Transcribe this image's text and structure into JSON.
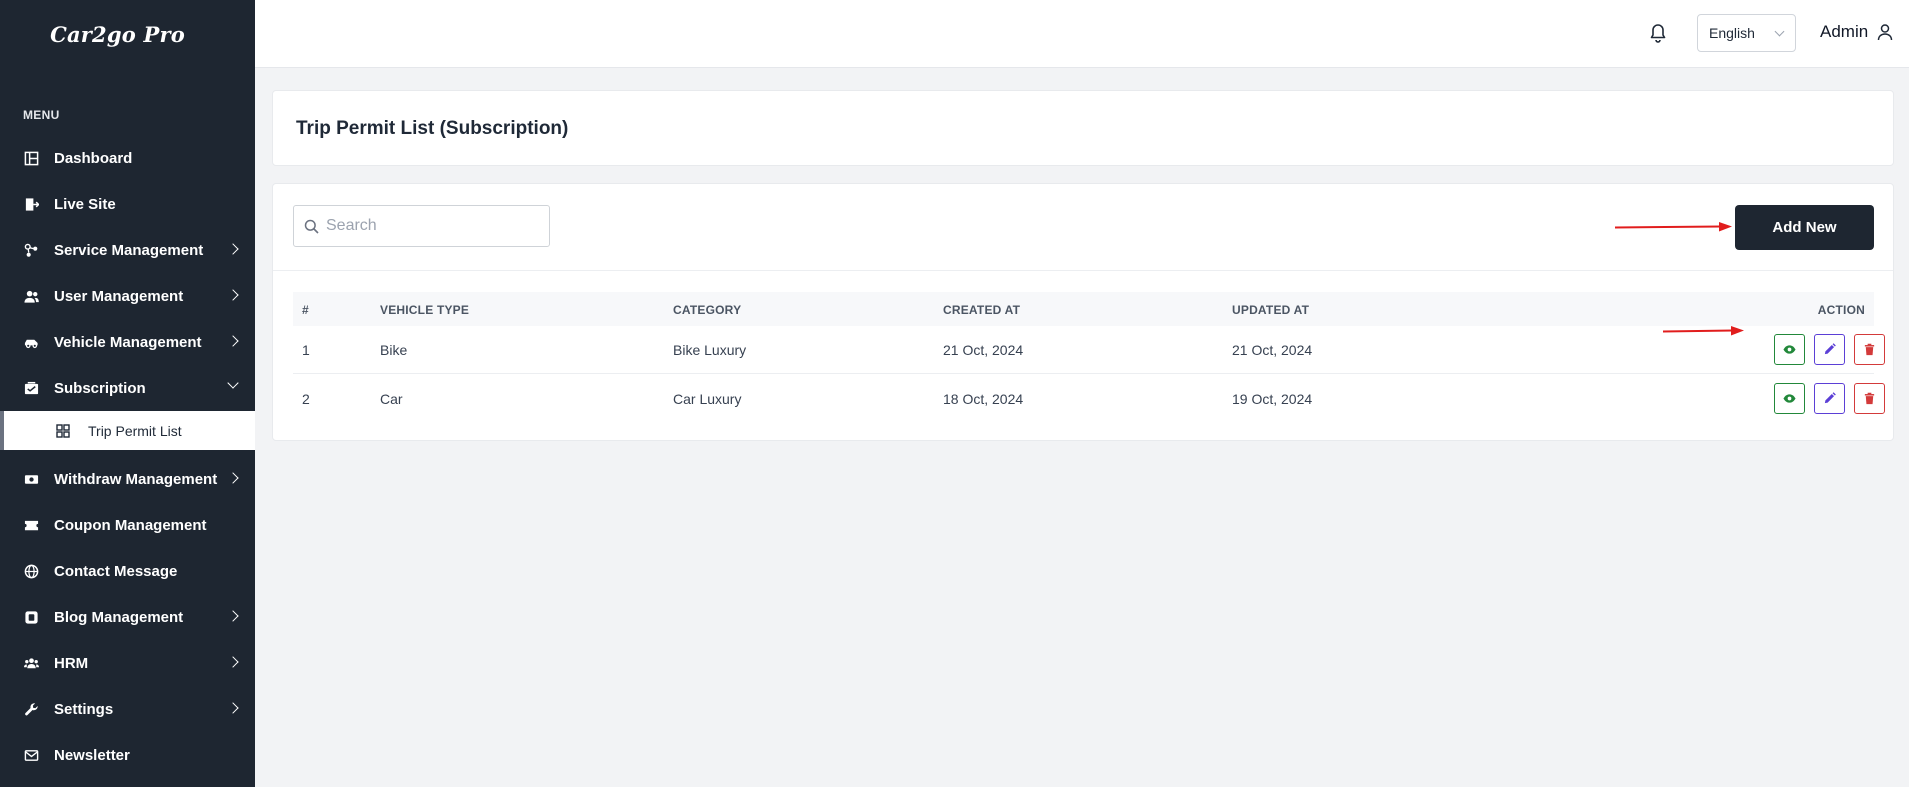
{
  "brand": "Car2go Pro",
  "sidebar": {
    "menu_heading": "MENU",
    "items": [
      {
        "label": "Dashboard"
      },
      {
        "label": "Live Site"
      },
      {
        "label": "Service Management"
      },
      {
        "label": "User Management"
      },
      {
        "label": "Vehicle Management"
      },
      {
        "label": "Subscription"
      },
      {
        "label": "Withdraw Management"
      },
      {
        "label": "Coupon Management"
      },
      {
        "label": "Contact Message"
      },
      {
        "label": "Blog Management"
      },
      {
        "label": "HRM"
      },
      {
        "label": "Settings"
      },
      {
        "label": "Newsletter"
      }
    ],
    "sub_item": {
      "label": "Trip Permit List"
    }
  },
  "topbar": {
    "language": "English",
    "user": "Admin"
  },
  "page": {
    "title": "Trip Permit List (Subscription)"
  },
  "toolbar": {
    "search_placeholder": "Search",
    "add_label": "Add New"
  },
  "table": {
    "headers": {
      "num": "#",
      "vehicle_type": "VEHICLE TYPE",
      "category": "CATEGORY",
      "created_at": "CREATED AT",
      "updated_at": "UPDATED AT",
      "action": "ACTION"
    },
    "rows": [
      {
        "num": "1",
        "vehicle_type": "Bike",
        "category": "Bike Luxury",
        "created_at": "21 Oct, 2024",
        "updated_at": "21 Oct, 2024"
      },
      {
        "num": "2",
        "vehicle_type": "Car",
        "category": "Car Luxury",
        "created_at": "18 Oct, 2024",
        "updated_at": "19 Oct, 2024"
      }
    ]
  },
  "colors": {
    "sidebar_bg": "#1e2631",
    "view": "#22883a",
    "edit": "#5b3fd6",
    "delete": "#d33a3a",
    "annotation_arrow": "#e11d1d"
  }
}
